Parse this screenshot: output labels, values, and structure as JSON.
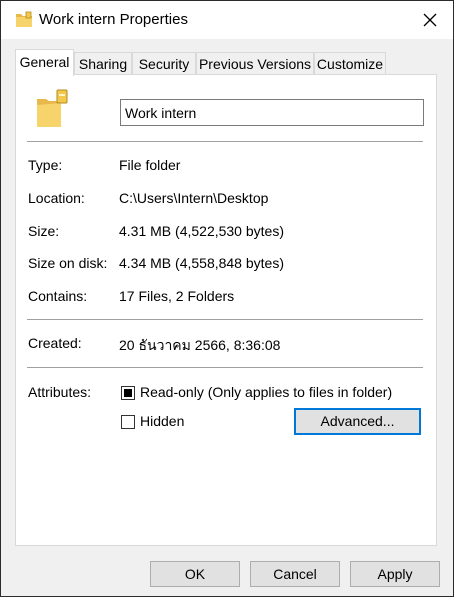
{
  "window": {
    "title": "Work intern Properties"
  },
  "tabs": [
    {
      "label": "General"
    },
    {
      "label": "Sharing"
    },
    {
      "label": "Security"
    },
    {
      "label": "Previous Versions"
    },
    {
      "label": "Customize"
    }
  ],
  "general": {
    "name_value": "Work intern",
    "rows": [
      {
        "label": "Type:",
        "value": "File folder"
      },
      {
        "label": "Location:",
        "value": "C:\\Users\\Intern\\Desktop"
      },
      {
        "label": "Size:",
        "value": "4.31 MB (4,522,530 bytes)"
      },
      {
        "label": "Size on disk:",
        "value": "4.34 MB (4,558,848 bytes)"
      },
      {
        "label": "Contains:",
        "value": "17 Files, 2 Folders"
      }
    ],
    "created_label": "Created:",
    "created_value": "20 ธันวาคม 2566, 8:36:08",
    "attributes_label": "Attributes:",
    "readonly_label": "Read-only (Only applies to files in folder)",
    "readonly_state": "indeterminate",
    "hidden_label": "Hidden",
    "hidden_checked": false,
    "advanced_label": "Advanced..."
  },
  "buttons": {
    "ok": "OK",
    "cancel": "Cancel",
    "apply": "Apply"
  },
  "colors": {
    "folder": "#f2c94c",
    "focus": "#0078d7"
  }
}
